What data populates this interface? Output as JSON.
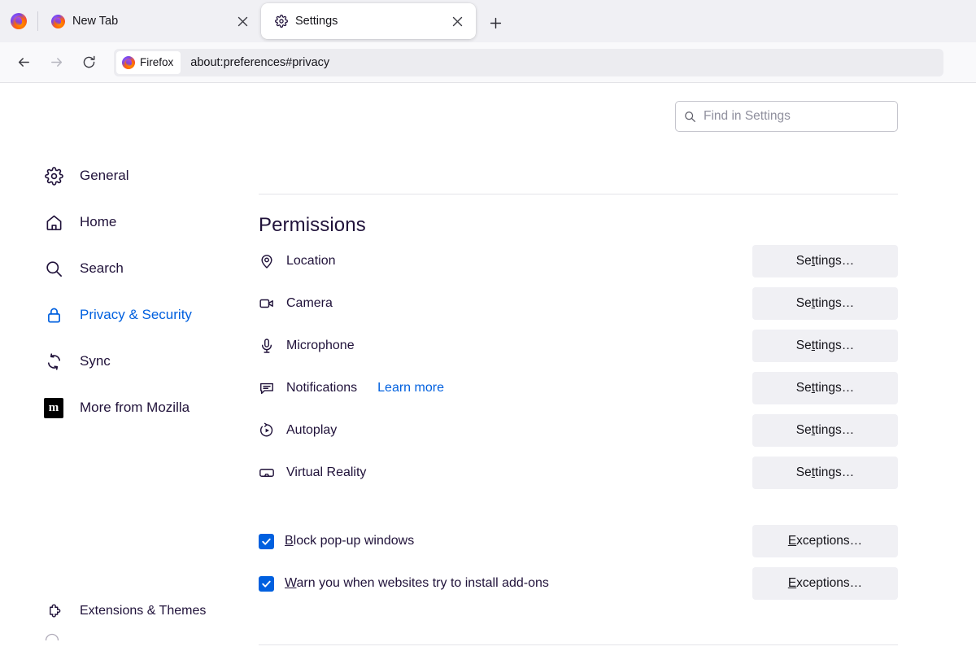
{
  "window": {
    "app_icon": "firefox-logo"
  },
  "tabs": [
    {
      "title": "New Tab",
      "favicon": "firefox-logo",
      "active": false,
      "close_icon": "close-icon"
    },
    {
      "title": "Settings",
      "favicon": "gear-icon",
      "active": true,
      "close_icon": "close-icon"
    }
  ],
  "new_tab_button": {
    "icon": "plus-icon",
    "label": "+"
  },
  "toolbar": {
    "back_icon": "back-arrow-icon",
    "forward_icon": "forward-arrow-icon",
    "reload_icon": "reload-icon",
    "identity_label": "Firefox",
    "identity_icon": "firefox-logo",
    "url": "about:preferences#privacy"
  },
  "search": {
    "placeholder": "Find in Settings",
    "icon": "search-icon",
    "value": ""
  },
  "sidebar": {
    "items": [
      {
        "label": "General",
        "icon": "gear-icon",
        "selected": false
      },
      {
        "label": "Home",
        "icon": "home-icon",
        "selected": false
      },
      {
        "label": "Search",
        "icon": "search-icon",
        "selected": false
      },
      {
        "label": "Privacy & Security",
        "icon": "lock-icon",
        "selected": true
      },
      {
        "label": "Sync",
        "icon": "sync-icon",
        "selected": false
      },
      {
        "label": "More from Mozilla",
        "icon": "mozilla-m-icon",
        "selected": false
      }
    ],
    "bottom_items": [
      {
        "label": "Extensions & Themes",
        "icon": "puzzle-piece-icon"
      }
    ],
    "mozilla_badge_letter": "m"
  },
  "main": {
    "section_title": "Permissions",
    "permissions": [
      {
        "label": "Location",
        "icon": "location-pin-icon",
        "button": "Settings…",
        "button_accesskey": "t"
      },
      {
        "label": "Camera",
        "icon": "camera-icon",
        "button": "Settings…",
        "button_accesskey": "t"
      },
      {
        "label": "Microphone",
        "icon": "microphone-icon",
        "button": "Settings…",
        "button_accesskey": "t"
      },
      {
        "label": "Notifications",
        "icon": "notification-bubble-icon",
        "link": "Learn more",
        "button": "Settings…",
        "button_accesskey": "t"
      },
      {
        "label": "Autoplay",
        "icon": "autoplay-icon",
        "button": "Settings…",
        "button_accesskey": "t"
      },
      {
        "label": "Virtual Reality",
        "icon": "vr-headset-icon",
        "button": "Settings…",
        "button_accesskey": "t"
      }
    ],
    "checkboxes": [
      {
        "label": "Block pop-up windows",
        "accesskey": "B",
        "checked": true,
        "button": "Exceptions…",
        "button_accesskey": "E"
      },
      {
        "label": "Warn you when websites try to install add-ons",
        "accesskey": "W",
        "checked": true,
        "button": "Exceptions…",
        "button_accesskey": "E"
      }
    ]
  },
  "colors": {
    "accent": "#0060df",
    "text": "#20123a",
    "button_bg": "#f0f0f4",
    "tabbar_bg": "#f0f0f4",
    "navbar_bg": "#f9f9fb"
  }
}
